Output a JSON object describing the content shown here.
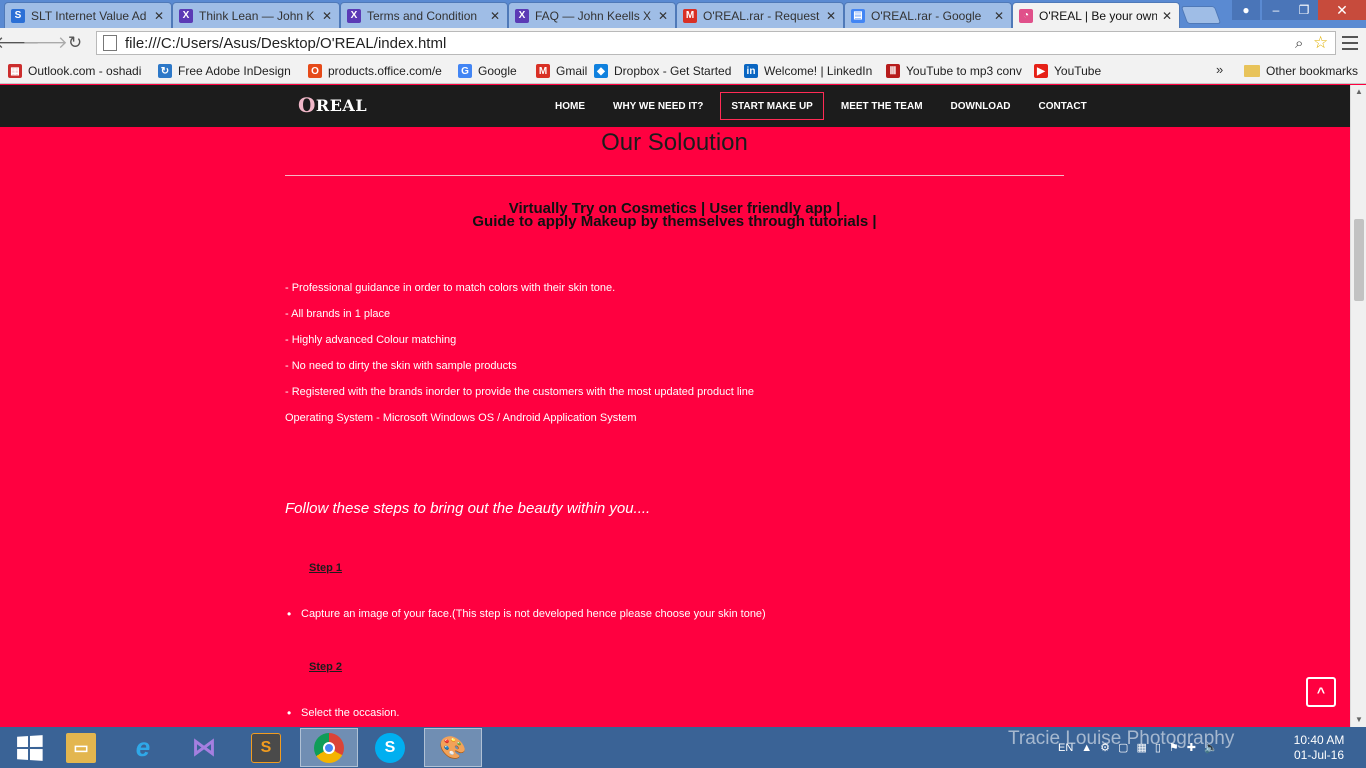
{
  "browser": {
    "tabs": [
      {
        "title": "SLT Internet Value Ad",
        "icon": "slt-icon",
        "color": "#2a6fd6",
        "glyph": "S",
        "active": false
      },
      {
        "title": "Think Lean — John K",
        "icon": "x-icon",
        "color": "#5b3ab5",
        "glyph": "X",
        "active": false
      },
      {
        "title": "Terms and Condition",
        "icon": "x-icon",
        "color": "#5b3ab5",
        "glyph": "X",
        "active": false
      },
      {
        "title": "FAQ — John Keells X",
        "icon": "x-icon",
        "color": "#5b3ab5",
        "glyph": "X",
        "active": false
      },
      {
        "title": "O'REAL.rar - Request",
        "icon": "gmail-icon",
        "color": "#d93025",
        "glyph": "M",
        "active": false
      },
      {
        "title": "O'REAL.rar - Google",
        "icon": "google-docs-icon",
        "color": "#4285f4",
        "glyph": "▤",
        "active": false
      },
      {
        "title": "O'REAL | Be your own",
        "icon": "oreal-icon",
        "color": "#e0508a",
        "glyph": "◔",
        "active": true
      }
    ],
    "url": "file:///C:/Users/Asus/Desktop/O'REAL/index.html",
    "bookmarks": [
      {
        "label": "Outlook.com - oshadi",
        "icon": "outlook-icon",
        "color": "#cc2e2e",
        "glyph": "▦"
      },
      {
        "label": "Free Adobe InDesign",
        "icon": "sync-icon",
        "color": "#2d78c8",
        "glyph": "↻"
      },
      {
        "label": "products.office.com/e",
        "icon": "office-icon",
        "color": "#e64a19",
        "glyph": "O"
      },
      {
        "label": "Google",
        "icon": "google-icon",
        "color": "#4285f4",
        "glyph": "G"
      },
      {
        "label": "Gmail",
        "icon": "gmail-icon",
        "color": "#d93025",
        "glyph": "M"
      },
      {
        "label": "Dropbox - Get Started",
        "icon": "dropbox-icon",
        "color": "#1081de",
        "glyph": "◆"
      },
      {
        "label": "Welcome! | LinkedIn",
        "icon": "linkedin-icon",
        "color": "#0a66c2",
        "glyph": "in"
      },
      {
        "label": "YouTube to mp3 conv",
        "icon": "mp3-icon",
        "color": "#b71c1c",
        "glyph": "Ⅲ"
      },
      {
        "label": "YouTube",
        "icon": "youtube-icon",
        "color": "#e62117",
        "glyph": "▶"
      }
    ],
    "bookmarks_more": "»",
    "other_bookmarks": "Other bookmarks"
  },
  "site": {
    "logo": {
      "first": "O",
      "rest": "REAL"
    },
    "nav": [
      "HOME",
      "WHY WE NEED IT?",
      "START MAKE UP",
      "MEET THE TEAM",
      "DOWNLOAD",
      "CONTACT"
    ],
    "active_nav": "START MAKE UP",
    "heading": "Our Soloution",
    "tagline_line1": "Virtually Try on Cosmetics | User friendly app |",
    "tagline_line2": "Guide to apply Makeup by themselves through tutorials |",
    "features": [
      "- Professional guidance in order to match colors with their skin tone.",
      "- All brands in 1 place",
      "- Highly advanced Colour matching",
      "- No need to dirty the skin with sample products",
      "- Registered with the brands inorder to provide the customers with the most updated product line",
      "Operating System - Microsoft Windows OS / Android Application System"
    ],
    "follow": "Follow these steps to bring out the beauty within you....",
    "steps": [
      {
        "title": "Step 1",
        "item": "Capture an image of your face.(This step is not developed hence please choose your skin tone)"
      },
      {
        "title": "Step 2",
        "item": "Select the occasion."
      }
    ],
    "back_to_top": "^",
    "accent": "#ff0040",
    "nav_bg": "#1c1c1c"
  },
  "taskbar": {
    "watermark": "Tracie Louise Photography",
    "language": "EN",
    "time": "10:40 AM",
    "date": "01-Jul-16"
  }
}
